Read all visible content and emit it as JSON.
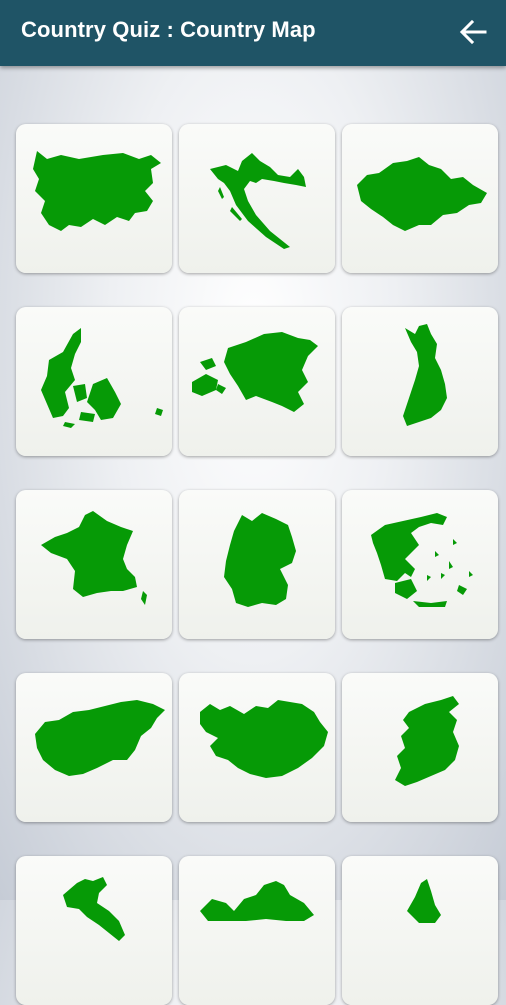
{
  "app": {
    "title": "Country Quiz : Country Map",
    "back_icon": "arrow-left-icon"
  },
  "colors": {
    "appbar": "#1f5466",
    "map_fill": "#069a06",
    "card_bg": "#f3f4f1"
  },
  "cards": [
    {
      "icon": "bulgaria-map-icon"
    },
    {
      "icon": "croatia-map-icon"
    },
    {
      "icon": "czechia-map-icon"
    },
    {
      "icon": "denmark-map-icon"
    },
    {
      "icon": "estonia-map-icon"
    },
    {
      "icon": "finland-map-icon"
    },
    {
      "icon": "france-map-icon"
    },
    {
      "icon": "germany-map-icon"
    },
    {
      "icon": "greece-map-icon"
    },
    {
      "icon": "hungary-map-icon"
    },
    {
      "icon": "iceland-map-icon"
    },
    {
      "icon": "ireland-map-icon"
    },
    {
      "icon": "italy-map-icon"
    },
    {
      "icon": "latvia-map-icon"
    },
    {
      "icon": "lithuania-map-icon"
    }
  ]
}
